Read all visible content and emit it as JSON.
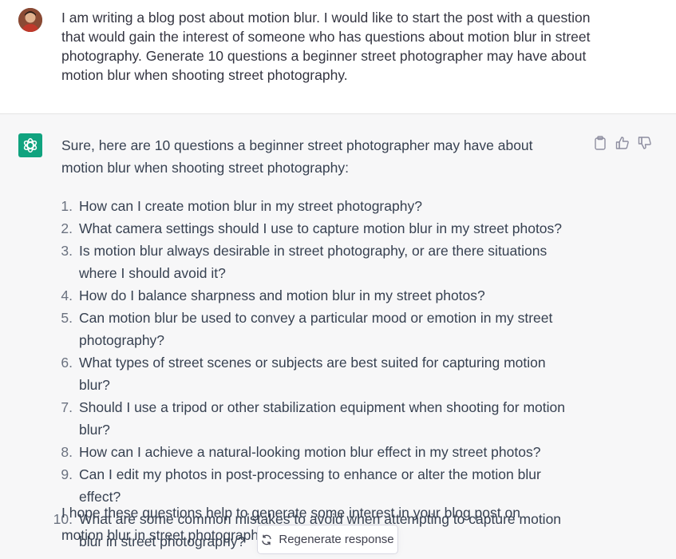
{
  "user": {
    "avatar_icon": "user-avatar",
    "prompt": "I am writing a blog post about motion blur. I would like to start the post with a question that would gain the interest of someone who has questions about motion blur in street photography. Generate 10 questions a beginner street photographer may have about motion blur when shooting street photography."
  },
  "assistant": {
    "logo_icon": "openai-logo",
    "accent_color": "#10a37f",
    "intro": "Sure, here are 10 questions a beginner street photographer may have about motion blur when shooting street photography:",
    "questions": [
      {
        "num": "1.",
        "text": "How can I create motion blur in my street photography?"
      },
      {
        "num": "2.",
        "text": "What camera settings should I use to capture motion blur in my street photos?"
      },
      {
        "num": "3.",
        "text": "Is motion blur always desirable in street photography, or are there situations where I should avoid it?"
      },
      {
        "num": "4.",
        "text": "How do I balance sharpness and motion blur in my street photos?"
      },
      {
        "num": "5.",
        "text": "Can motion blur be used to convey a particular mood or emotion in my street photography?"
      },
      {
        "num": "6.",
        "text": "What types of street scenes or subjects are best suited for capturing motion blur?"
      },
      {
        "num": "7.",
        "text": "Should I use a tripod or other stabilization equipment when shooting for motion blur?"
      },
      {
        "num": "8.",
        "text": "How can I achieve a natural-looking motion blur effect in my street photos?"
      },
      {
        "num": "9.",
        "text": "Can I edit my photos in post-processing to enhance or alter the motion blur effect?"
      },
      {
        "num": "10.",
        "text": "What are some common mistakes to avoid when attempting to capture motion blur in street photography?"
      }
    ],
    "outro": "I hope these questions help to generate some interest in your blog post on motion blur in street photography!",
    "feedback_icons": [
      "clipboard-icon",
      "thumbs-up-icon",
      "thumbs-down-icon"
    ]
  },
  "regenerate": {
    "icon": "refresh-icon",
    "label": "Regenerate response"
  }
}
